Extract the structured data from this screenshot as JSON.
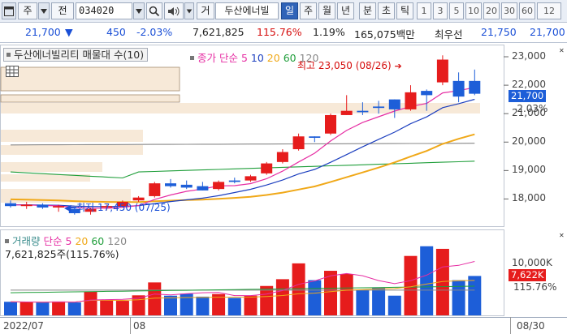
{
  "toolbar": {
    "market": "주",
    "code_label": "전",
    "code": "034020",
    "chart_kind": "거",
    "stock_name": "두산에너빌",
    "periods": [
      "일",
      "주",
      "월",
      "년",
      "분",
      "초",
      "틱"
    ],
    "active_period": "일",
    "intervals": [
      "1",
      "3",
      "5",
      "10",
      "20",
      "30",
      "60",
      "12"
    ]
  },
  "info": {
    "price": "21,700",
    "change_arrow": "▼",
    "change": "450",
    "change_pct": "-2.03%",
    "volume": "7,621,825",
    "volume_ratio": "115.76%",
    "turnover": "1.19%",
    "amount": "165,075백만",
    "best_ask_label": "최우선",
    "ask": "21,750",
    "bid": "21,700"
  },
  "price_panel": {
    "title": "두산에너빌리티 매물대 수(10)",
    "ma_label": "종가 단순",
    "ma_periods": [
      "5",
      "10",
      "20",
      "60",
      "120"
    ],
    "high_note": "최고 23,050 (08/26)",
    "low_note": "최저 17,450 (07/25)",
    "y_ticks": [
      "23,000",
      "22,000",
      "21,000",
      "20,000",
      "19,000",
      "18,000"
    ],
    "last_price_tag": "21,700",
    "last_change_tag": "-2.03%"
  },
  "volume_panel": {
    "title": "거래량",
    "ma_label": "단순",
    "ma_periods": [
      "5",
      "20",
      "60",
      "120"
    ],
    "last_volume": "7,621,825주(115.76%)",
    "y_tick": "10,000K",
    "last_tag": "7,622K",
    "last_ratio_tag": "115.76%"
  },
  "x_axis": {
    "labels": [
      "2022/07",
      "08"
    ],
    "right_label": "08/30"
  },
  "colors": {
    "up": "#e61c1c",
    "down": "#1d5ed8",
    "ma5": "#e62ea3",
    "ma10": "#1c3fbf",
    "ma20": "#f0a818",
    "ma60": "#1f9e3a",
    "ma120": "#888888"
  },
  "chart_data": {
    "type": "candlestick",
    "dates": [
      "07/19",
      "07/20",
      "07/21",
      "07/22",
      "07/25",
      "07/26",
      "07/27",
      "07/28",
      "07/29",
      "08/01",
      "08/02",
      "08/03",
      "08/04",
      "08/05",
      "08/08",
      "08/09",
      "08/10",
      "08/11",
      "08/12",
      "08/16",
      "08/17",
      "08/18",
      "08/19",
      "08/22",
      "08/23",
      "08/24",
      "08/25",
      "08/26",
      "08/29",
      "08/30"
    ],
    "ohlc": [
      [
        17850,
        17950,
        17700,
        17750
      ],
      [
        17750,
        17900,
        17650,
        17800
      ],
      [
        17800,
        17850,
        17650,
        17700
      ],
      [
        17700,
        17800,
        17550,
        17750
      ],
      [
        17650,
        17700,
        17450,
        17500
      ],
      [
        17550,
        17700,
        17450,
        17650
      ],
      [
        17700,
        17800,
        17600,
        17750
      ],
      [
        17750,
        17950,
        17700,
        17900
      ],
      [
        17950,
        18100,
        17900,
        18050
      ],
      [
        18100,
        18600,
        18050,
        18550
      ],
      [
        18550,
        18700,
        18400,
        18450
      ],
      [
        18500,
        18650,
        18350,
        18400
      ],
      [
        18450,
        18600,
        18300,
        18300
      ],
      [
        18350,
        18650,
        18300,
        18600
      ],
      [
        18650,
        18750,
        18550,
        18600
      ],
      [
        18650,
        18850,
        18600,
        18800
      ],
      [
        18900,
        19300,
        18850,
        19250
      ],
      [
        19300,
        19750,
        19250,
        19650
      ],
      [
        19750,
        20300,
        19700,
        20200
      ],
      [
        20200,
        20200,
        20000,
        20150
      ],
      [
        20300,
        21000,
        20250,
        20950
      ],
      [
        20950,
        21650,
        20950,
        21100
      ],
      [
        21100,
        21400,
        20950,
        21050
      ],
      [
        21250,
        21450,
        21000,
        21200
      ],
      [
        21500,
        21500,
        20850,
        21150
      ],
      [
        21150,
        22000,
        21100,
        21750
      ],
      [
        21800,
        21850,
        21100,
        21650
      ],
      [
        22100,
        23050,
        22000,
        22900
      ],
      [
        22150,
        22450,
        21400,
        21600
      ],
      [
        22150,
        22550,
        21650,
        21700
      ]
    ],
    "volume_k": [
      2100,
      2050,
      2000,
      2150,
      2000,
      3650,
      2400,
      2250,
      3100,
      5100,
      3050,
      3350,
      2900,
      3300,
      2700,
      3050,
      4550,
      5600,
      8050,
      5450,
      6900,
      6400,
      3900,
      4300,
      3050,
      9200,
      10700,
      10300,
      5450,
      6100
    ],
    "ylim": [
      17300,
      23200
    ]
  }
}
